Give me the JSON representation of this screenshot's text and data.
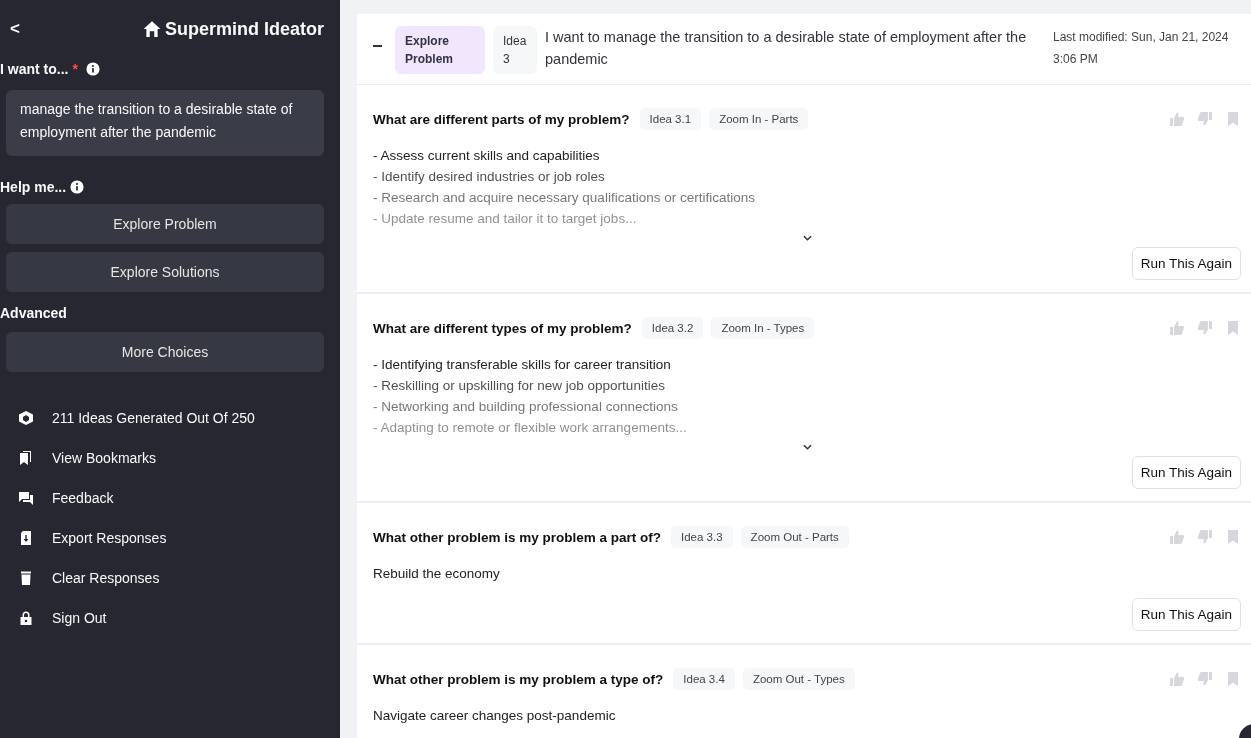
{
  "sidebar": {
    "back": "<",
    "title": "Supermind Ideator",
    "goal_label": "I want to...",
    "required_mark": "*",
    "goal_value": "manage the transition to a desirable state of employment after the pandemic",
    "help_label": "Help me...",
    "help_buttons": [
      "Explore Problem",
      "Explore Solutions"
    ],
    "advanced_label": "Advanced",
    "advanced_buttons": [
      "More Choices"
    ],
    "menu": [
      {
        "label": "211 Ideas Generated Out Of 250"
      },
      {
        "label": "View Bookmarks"
      },
      {
        "label": "Feedback"
      },
      {
        "label": "Export Responses"
      },
      {
        "label": "Clear Responses"
      },
      {
        "label": "Sign Out"
      }
    ]
  },
  "header": {
    "expanded": true,
    "tag": "Explore Problem",
    "idea": "Idea 3",
    "statement": "I want to manage the transition to a desirable state of employment after the pandemic",
    "modified": "Last modified: Sun, Jan 21, 2024 3:06 PM"
  },
  "sections": [
    {
      "question": "What are different parts of my problem?",
      "idea": "Idea 3.1",
      "move": "Zoom In - Parts",
      "expandable": true,
      "lines": [
        "- Assess current skills and capabilities",
        "- Identify desired industries or job roles",
        "- Research and acquire necessary qualifications or certifications",
        "- Update resume and tailor it to target jobs..."
      ],
      "button": "Run This Again"
    },
    {
      "question": "What are different types of my problem?",
      "idea": "Idea 3.2",
      "move": "Zoom In - Types",
      "expandable": true,
      "lines": [
        "- Identifying transferable skills for career transition",
        "- Reskilling or upskilling for new job opportunities",
        "- Networking and building professional connections",
        "- Adapting to remote or flexible work arrangements..."
      ],
      "button": "Run This Again"
    },
    {
      "question": "What other problem is my problem a part of?",
      "idea": "Idea 3.3",
      "move": "Zoom Out - Parts",
      "expandable": false,
      "lines": [
        "Rebuild the economy"
      ],
      "button": "Run This Again"
    },
    {
      "question": "What other problem is my problem a type of?",
      "idea": "Idea 3.4",
      "move": "Zoom Out - Types",
      "expandable": false,
      "lines": [
        "Navigate career changes post-pandemic"
      ]
    }
  ]
}
